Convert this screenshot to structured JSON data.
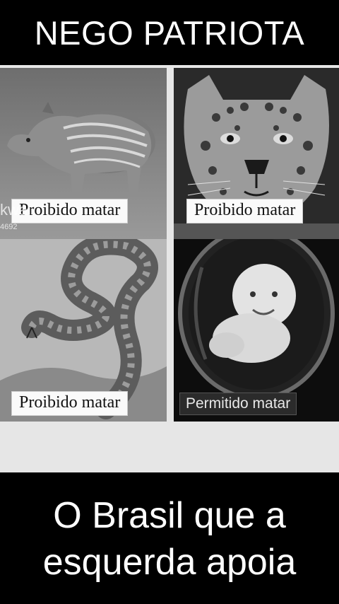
{
  "header": {
    "title": "NEGO PATRIOTA"
  },
  "panels": [
    {
      "animal": "tapir-calf",
      "label": "Proibido matar"
    },
    {
      "animal": "jaguar",
      "label": "Proibido matar"
    },
    {
      "animal": "rattlesnake",
      "label": "Proibido matar"
    },
    {
      "animal": "baby-in-womb",
      "label": "Permitido matar"
    }
  ],
  "watermark": {
    "text1": "kwai",
    "text2": "4692"
  },
  "footer": {
    "line1": "O Brasil que a",
    "line2": "esquerda apoia"
  }
}
